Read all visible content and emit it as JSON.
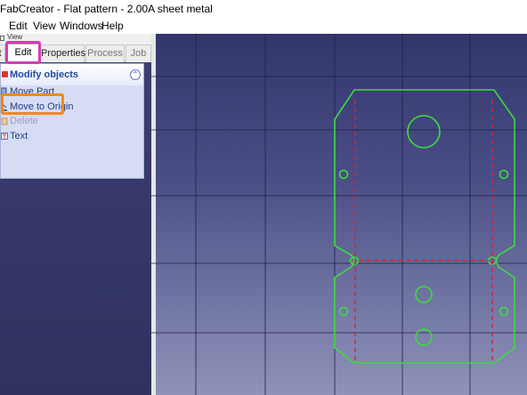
{
  "window": {
    "title": "FabCreator - Flat pattern - 2.00A sheet metal"
  },
  "menu": {
    "items": [
      "Edit",
      "View",
      "Windows",
      "Help"
    ]
  },
  "panel": {
    "header": "View",
    "tabs": [
      "t",
      "Edit",
      "Properties",
      "Process",
      "Job"
    ],
    "task_group": {
      "title": "Modify objects",
      "collapse_icon": "chevron-up-icon",
      "items": [
        {
          "label": "Move Part",
          "icon": "move-part-icon",
          "enabled": true
        },
        {
          "label": "Move to Origin",
          "icon": "move-origin-icon",
          "enabled": true
        },
        {
          "label": "Delete",
          "icon": "delete-icon",
          "enabled": false
        },
        {
          "label": "Text",
          "icon": "text-icon",
          "enabled": true
        }
      ]
    }
  },
  "colors": {
    "outline": "#3cdc3c",
    "bend_line": "#e0202a",
    "grid": "#1a1c3a",
    "highlight_edit": "#d63ab8",
    "highlight_move_origin": "#f2871f",
    "link": "#1f3c8f"
  }
}
